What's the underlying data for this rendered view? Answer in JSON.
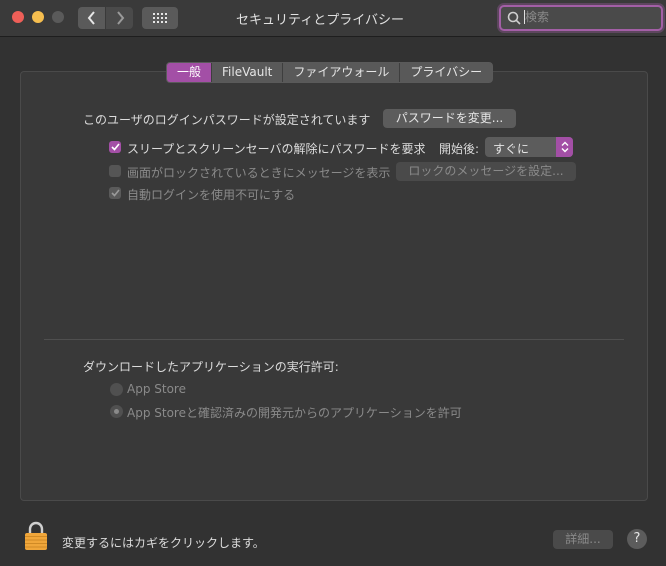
{
  "window": {
    "title": "セキュリティとプライバシー"
  },
  "search": {
    "placeholder": "検索",
    "value": ""
  },
  "tabs": [
    {
      "label": "一般",
      "active": true
    },
    {
      "label": "FileVault",
      "active": false
    },
    {
      "label": "ファイアウォール",
      "active": false
    },
    {
      "label": "プライバシー",
      "active": false
    }
  ],
  "general": {
    "password_set_text": "このユーザのログインパスワードが設定されています",
    "change_password_button": "パスワードを変更...",
    "require_password_label": "スリープとスクリーンセーバの解除にパスワードを要求",
    "require_password_checked": true,
    "after_label": "開始後:",
    "after_value": "すぐに",
    "lock_message_label": "画面がロックされているときにメッセージを表示",
    "lock_message_checked": false,
    "lock_message_button": "ロックのメッセージを設定...",
    "disable_autologin_label": "自動ログインを使用不可にする",
    "disable_autologin_checked": true
  },
  "downloads": {
    "heading": "ダウンロードしたアプリケーションの実行許可:",
    "options": [
      {
        "label": "App Store",
        "selected": false
      },
      {
        "label": "App Storeと確認済みの開発元からのアプリケーションを許可",
        "selected": true
      }
    ]
  },
  "footer": {
    "lock_text": "変更するにはカギをクリックします。",
    "advanced_button": "詳細...",
    "help_label": "?"
  },
  "colors": {
    "accent": "#a34fa6",
    "lock": "#f0a63a"
  }
}
